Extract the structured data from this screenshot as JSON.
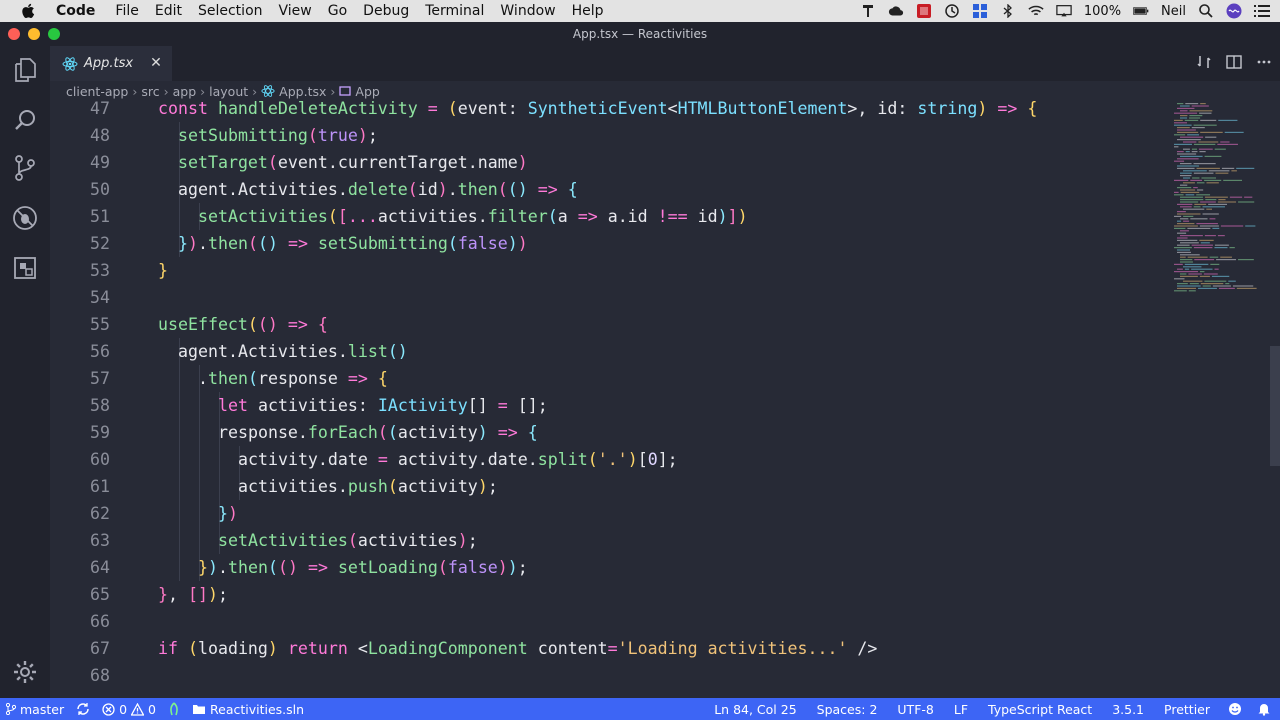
{
  "menubar": {
    "app_name": "Code",
    "items": [
      "File",
      "Edit",
      "Selection",
      "View",
      "Go",
      "Debug",
      "Terminal",
      "Window",
      "Help"
    ],
    "battery": "100%",
    "user": "Neil"
  },
  "window": {
    "title": "App.tsx — Reactivities"
  },
  "tabs": [
    {
      "label": "App.tsx",
      "close": "✕"
    }
  ],
  "breadcrumb": [
    "client-app",
    "src",
    "app",
    "layout",
    "App.tsx",
    "App"
  ],
  "editor": {
    "lines": [
      {
        "n": "47",
        "indent": 1,
        "code": [
          [
            "k",
            "const "
          ],
          [
            "f",
            "handleDeleteActivity"
          ],
          [
            "punc",
            " "
          ],
          [
            "op",
            "="
          ],
          [
            "punc",
            " "
          ],
          [
            "p",
            "("
          ],
          [
            "v",
            "event"
          ],
          [
            "punc",
            ": "
          ],
          [
            "t",
            "SyntheticEvent"
          ],
          [
            "punc",
            "<"
          ],
          [
            "t",
            "HTMLButtonElement"
          ],
          [
            "punc",
            ">, "
          ],
          [
            "v",
            "id"
          ],
          [
            "punc",
            ": "
          ],
          [
            "t",
            "string"
          ],
          [
            "p",
            ")"
          ],
          [
            "punc",
            " "
          ],
          [
            "op",
            "=>"
          ],
          [
            "punc",
            " "
          ],
          [
            "p",
            "{"
          ]
        ]
      },
      {
        "n": "48",
        "indent": 2,
        "code": [
          [
            "f",
            "setSubmitting"
          ],
          [
            "b2",
            "("
          ],
          [
            "bool",
            "true"
          ],
          [
            "b2",
            ")"
          ],
          [
            "punc",
            ";"
          ]
        ]
      },
      {
        "n": "49",
        "indent": 2,
        "code": [
          [
            "f",
            "setTarget"
          ],
          [
            "b2",
            "("
          ],
          [
            "v",
            "event.currentTarget.name"
          ],
          [
            "b2",
            ")"
          ]
        ]
      },
      {
        "n": "50",
        "indent": 2,
        "code": [
          [
            "v",
            "agent.Activities."
          ],
          [
            "f",
            "delete"
          ],
          [
            "b2",
            "("
          ],
          [
            "v",
            "id"
          ],
          [
            "b2",
            ")"
          ],
          [
            "punc",
            "."
          ],
          [
            "f",
            "then"
          ],
          [
            "b2",
            "("
          ],
          [
            "b3",
            "()"
          ],
          [
            "punc",
            " "
          ],
          [
            "op",
            "=>"
          ],
          [
            "punc",
            " "
          ],
          [
            "b3",
            "{"
          ]
        ]
      },
      {
        "n": "51",
        "indent": 3,
        "code": [
          [
            "f",
            "setActivities"
          ],
          [
            "p",
            "("
          ],
          [
            "b2",
            "["
          ],
          [
            "op",
            "..."
          ],
          [
            "v",
            "activities."
          ],
          [
            "f",
            "filter"
          ],
          [
            "b3",
            "("
          ],
          [
            "v",
            "a"
          ],
          [
            "punc",
            " "
          ],
          [
            "op",
            "=>"
          ],
          [
            "punc",
            " "
          ],
          [
            "v",
            "a.id"
          ],
          [
            "punc",
            " "
          ],
          [
            "op",
            "!=="
          ],
          [
            "punc",
            " "
          ],
          [
            "v",
            "id"
          ],
          [
            "b3",
            ")"
          ],
          [
            "b2",
            "]"
          ],
          [
            "p",
            ")"
          ]
        ]
      },
      {
        "n": "52",
        "indent": 2,
        "code": [
          [
            "b3",
            "}"
          ],
          [
            "b2",
            ")"
          ],
          [
            "punc",
            "."
          ],
          [
            "f",
            "then"
          ],
          [
            "b2",
            "("
          ],
          [
            "b3",
            "()"
          ],
          [
            "punc",
            " "
          ],
          [
            "op",
            "=>"
          ],
          [
            "punc",
            " "
          ],
          [
            "f",
            "setSubmitting"
          ],
          [
            "b3",
            "("
          ],
          [
            "bool",
            "false"
          ],
          [
            "b3",
            ")"
          ],
          [
            "b2",
            ")"
          ]
        ]
      },
      {
        "n": "53",
        "indent": 1,
        "code": [
          [
            "p",
            "}"
          ]
        ]
      },
      {
        "n": "54",
        "indent": 0,
        "code": []
      },
      {
        "n": "55",
        "indent": 1,
        "code": [
          [
            "f",
            "useEffect"
          ],
          [
            "p",
            "("
          ],
          [
            "b2",
            "()"
          ],
          [
            "punc",
            " "
          ],
          [
            "op",
            "=>"
          ],
          [
            "punc",
            " "
          ],
          [
            "b2",
            "{"
          ]
        ]
      },
      {
        "n": "56",
        "indent": 2,
        "code": [
          [
            "v",
            "agent.Activities."
          ],
          [
            "f",
            "list"
          ],
          [
            "b3",
            "()"
          ]
        ]
      },
      {
        "n": "57",
        "indent": 3,
        "code": [
          [
            "punc",
            "."
          ],
          [
            "f",
            "then"
          ],
          [
            "b3",
            "("
          ],
          [
            "v",
            "response"
          ],
          [
            "punc",
            " "
          ],
          [
            "op",
            "=>"
          ],
          [
            "punc",
            " "
          ],
          [
            "p",
            "{"
          ]
        ]
      },
      {
        "n": "58",
        "indent": 4,
        "code": [
          [
            "k",
            "let "
          ],
          [
            "v",
            "activities"
          ],
          [
            "punc",
            ": "
          ],
          [
            "t",
            "IActivity"
          ],
          [
            "punc",
            "[] "
          ],
          [
            "op",
            "="
          ],
          [
            "punc",
            " [];"
          ]
        ]
      },
      {
        "n": "59",
        "indent": 4,
        "code": [
          [
            "v",
            "response."
          ],
          [
            "f",
            "forEach"
          ],
          [
            "b2",
            "("
          ],
          [
            "b3",
            "("
          ],
          [
            "v",
            "activity"
          ],
          [
            "b3",
            ")"
          ],
          [
            "punc",
            " "
          ],
          [
            "op",
            "=>"
          ],
          [
            "punc",
            " "
          ],
          [
            "b3",
            "{"
          ]
        ]
      },
      {
        "n": "60",
        "indent": 5,
        "code": [
          [
            "v",
            "activity.date"
          ],
          [
            "punc",
            " "
          ],
          [
            "op",
            "="
          ],
          [
            "punc",
            " "
          ],
          [
            "v",
            "activity.date."
          ],
          [
            "f",
            "split"
          ],
          [
            "p",
            "("
          ],
          [
            "s",
            "'.'"
          ],
          [
            "p",
            ")"
          ],
          [
            "punc",
            "["
          ],
          [
            "num",
            "0"
          ],
          [
            "punc",
            "];"
          ]
        ]
      },
      {
        "n": "61",
        "indent": 5,
        "code": [
          [
            "v",
            "activities."
          ],
          [
            "f",
            "push"
          ],
          [
            "p",
            "("
          ],
          [
            "v",
            "activity"
          ],
          [
            "p",
            ")"
          ],
          [
            "punc",
            ";"
          ]
        ]
      },
      {
        "n": "62",
        "indent": 4,
        "code": [
          [
            "b3",
            "}"
          ],
          [
            "b2",
            ")"
          ]
        ]
      },
      {
        "n": "63",
        "indent": 4,
        "code": [
          [
            "f",
            "setActivities"
          ],
          [
            "b2",
            "("
          ],
          [
            "v",
            "activities"
          ],
          [
            "b2",
            ")"
          ],
          [
            "punc",
            ";"
          ]
        ]
      },
      {
        "n": "64",
        "indent": 3,
        "code": [
          [
            "p",
            "}"
          ],
          [
            "b3",
            ")"
          ],
          [
            "punc",
            "."
          ],
          [
            "f",
            "then"
          ],
          [
            "b3",
            "("
          ],
          [
            "b2",
            "()"
          ],
          [
            "punc",
            " "
          ],
          [
            "op",
            "=>"
          ],
          [
            "punc",
            " "
          ],
          [
            "f",
            "setLoading"
          ],
          [
            "b2",
            "("
          ],
          [
            "bool",
            "false"
          ],
          [
            "b2",
            ")"
          ],
          [
            "b3",
            ")"
          ],
          [
            "punc",
            ";"
          ]
        ]
      },
      {
        "n": "65",
        "indent": 1,
        "code": [
          [
            "b2",
            "}"
          ],
          [
            "punc",
            ", "
          ],
          [
            "b2",
            "[]"
          ],
          [
            "p",
            ")"
          ],
          [
            "punc",
            ";"
          ]
        ]
      },
      {
        "n": "66",
        "indent": 0,
        "code": []
      },
      {
        "n": "67",
        "indent": 1,
        "code": [
          [
            "k",
            "if "
          ],
          [
            "p",
            "("
          ],
          [
            "v",
            "loading"
          ],
          [
            "p",
            ")"
          ],
          [
            "punc",
            " "
          ],
          [
            "k",
            "return "
          ],
          [
            "punc",
            "<"
          ],
          [
            "tag",
            "LoadingComponent"
          ],
          [
            "punc",
            " "
          ],
          [
            "v",
            "content"
          ],
          [
            "op",
            "="
          ],
          [
            "s",
            "'Loading activities...'"
          ],
          [
            "punc",
            " />"
          ]
        ]
      },
      {
        "n": "68",
        "indent": 0,
        "code": []
      }
    ]
  },
  "statusbar": {
    "branch": "master",
    "errors": "0",
    "warnings": "0",
    "solution": "Reactivities.sln",
    "position": "Ln 84, Col 25",
    "spaces": "Spaces: 2",
    "encoding": "UTF-8",
    "eol": "LF",
    "language": "TypeScript React",
    "ts_version": "3.5.1",
    "formatter": "Prettier"
  }
}
